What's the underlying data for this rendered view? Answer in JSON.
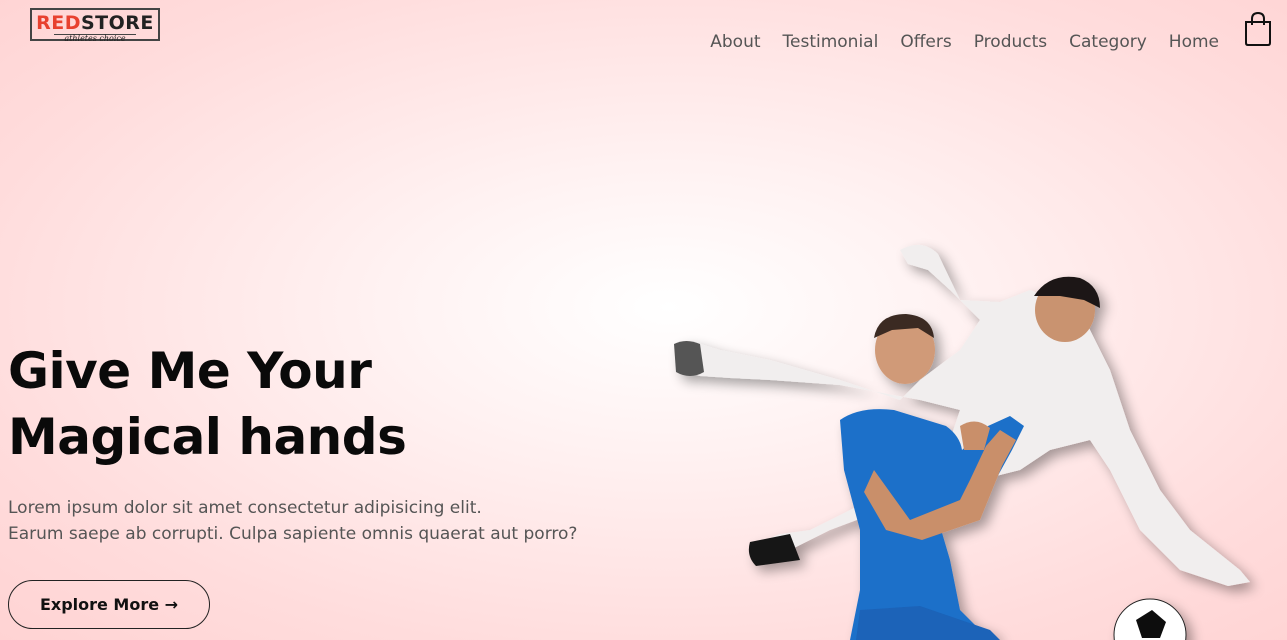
{
  "logo": {
    "brand_red": "RED",
    "brand_dark": "STORE",
    "tagline": "athletes choice"
  },
  "nav": {
    "items": [
      {
        "label": "About"
      },
      {
        "label": "Testimonial"
      },
      {
        "label": "Offers"
      },
      {
        "label": "Products"
      },
      {
        "label": "Category"
      },
      {
        "label": "Home"
      }
    ]
  },
  "cart": {
    "icon": "shopping-bag-icon"
  },
  "hero": {
    "title_line1": "Give Me Your",
    "title_line2": "Magical hands",
    "text_line1": "Lorem ipsum dolor sit amet consectetur adipisicing elit.",
    "text_line2": "Earum saepe ab corrupti. Culpa sapiente omnis quaerat aut porro?",
    "button_label": "Explore More →"
  },
  "colors": {
    "accent": "#e8412f",
    "text": "#111111",
    "nav": "#555555",
    "background": "#ffd6d6"
  }
}
